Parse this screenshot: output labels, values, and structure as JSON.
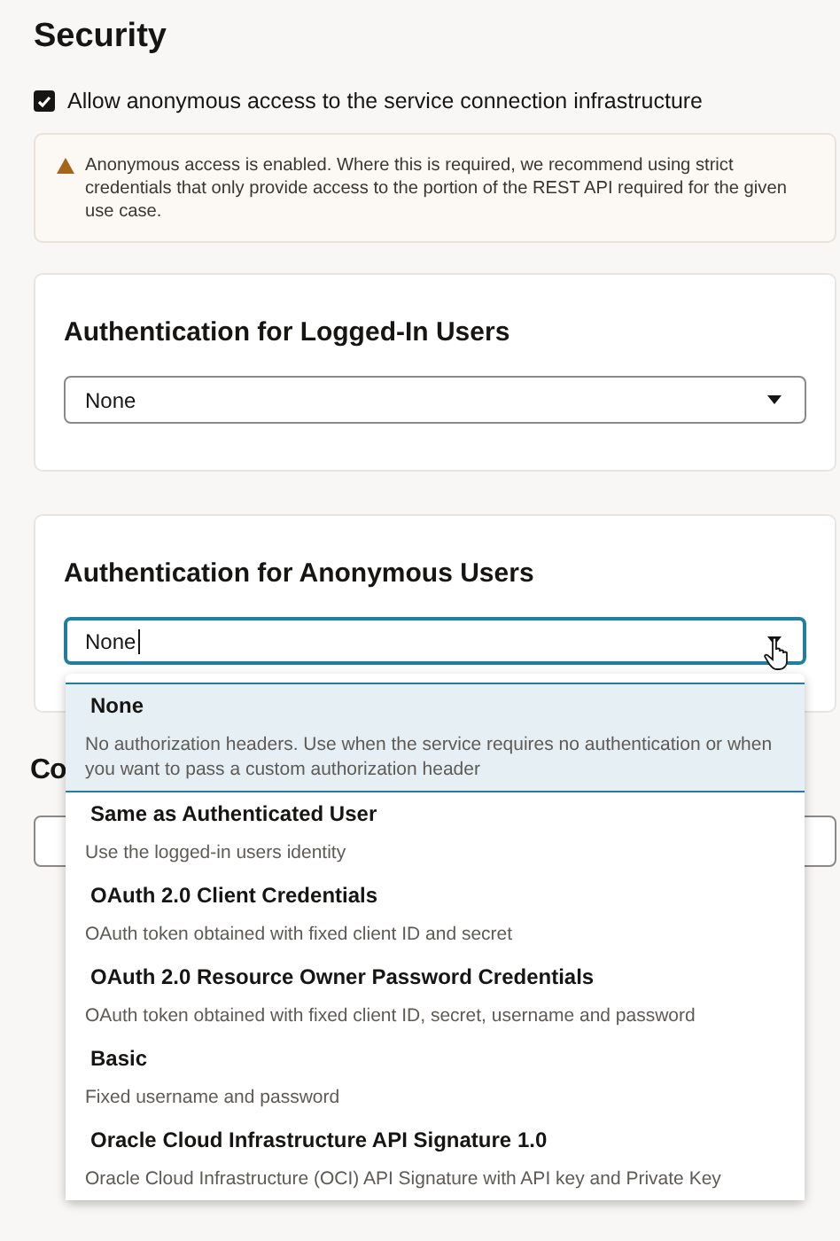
{
  "title": "Security",
  "anonymous_access": {
    "label": "Allow anonymous access to the service connection infrastructure",
    "checked": true
  },
  "warning": {
    "text": "Anonymous access is enabled. Where this is required, we recommend using strict credentials that only provide access to the portion of the REST API required for the given use case."
  },
  "cards": [
    {
      "heading": "Authentication for Logged-In Users",
      "select": {
        "value": "None",
        "focused": false,
        "expanded": false
      }
    },
    {
      "heading": "Authentication for Anonymous Users",
      "select": {
        "value": "None",
        "focused": true,
        "expanded": true
      }
    }
  ],
  "next_section": {
    "heading": "Co"
  },
  "dropdown_options": [
    {
      "title": "None",
      "description": "No authorization headers. Use when the service requires no authentication or when you want to pass a custom authorization header",
      "selected": true
    },
    {
      "title": "Same as Authenticated User",
      "description": "Use the logged-in users identity",
      "selected": false
    },
    {
      "title": "OAuth 2.0 Client Credentials",
      "description": "OAuth token obtained with fixed client ID and secret",
      "selected": false
    },
    {
      "title": "OAuth 2.0 Resource Owner Password Credentials",
      "description": "OAuth token obtained with fixed client ID, secret, username and password",
      "selected": false
    },
    {
      "title": "Basic",
      "description": "Fixed username and password",
      "selected": false
    },
    {
      "title": "Oracle Cloud Infrastructure API Signature 1.0",
      "description": "Oracle Cloud Infrastructure (OCI) API Signature with API key and Private Key",
      "selected": false
    }
  ]
}
